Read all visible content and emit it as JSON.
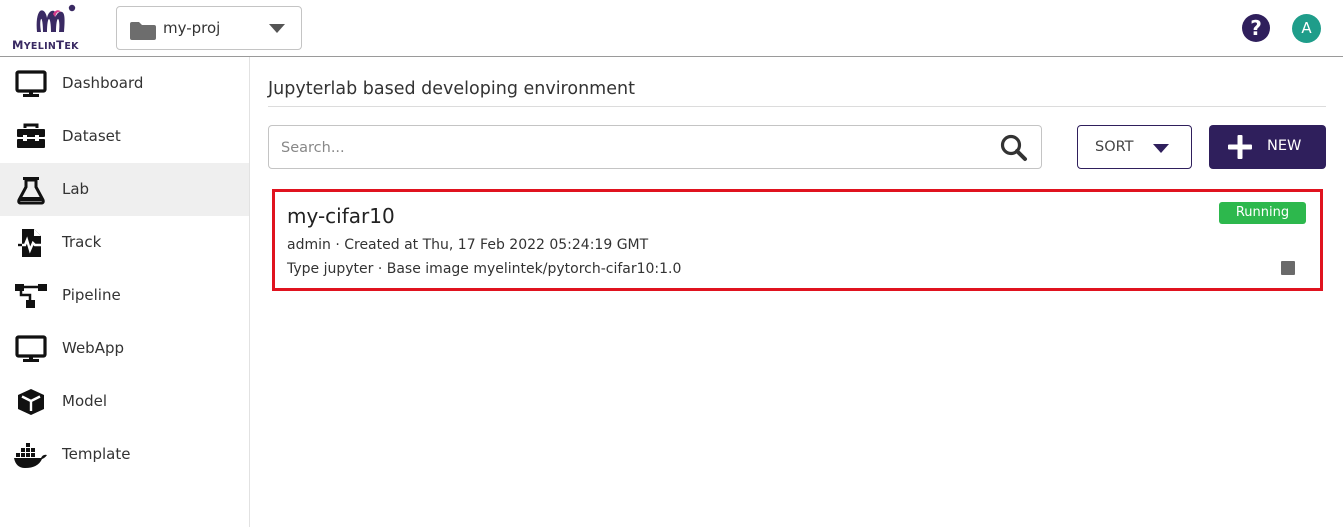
{
  "header": {
    "logo_text_big": "M",
    "logo_text_small": "YELIN",
    "logo_text_big2": "T",
    "logo_text_small2": "EK",
    "project": "my-proj",
    "help_glyph": "?",
    "avatar_letter": "A",
    "icons": [
      "folder-icon",
      "chevron-down-icon",
      "help-icon"
    ]
  },
  "sidebar": {
    "items": [
      {
        "label": "Dashboard",
        "icon": "monitor-icon"
      },
      {
        "label": "Dataset",
        "icon": "toolbox-icon"
      },
      {
        "label": "Lab",
        "icon": "flask-icon",
        "active": true
      },
      {
        "label": "Track",
        "icon": "file-pulse-icon"
      },
      {
        "label": "Pipeline",
        "icon": "sitemap-icon"
      },
      {
        "label": "WebApp",
        "icon": "monitor-icon"
      },
      {
        "label": "Model",
        "icon": "cube-icon"
      },
      {
        "label": "Template",
        "icon": "docker-icon"
      }
    ]
  },
  "main": {
    "title": "Jupyterlab based developing environment",
    "search_placeholder": "Search...",
    "sort_label": "SORT",
    "new_label": "NEW"
  },
  "labs": [
    {
      "name": "my-cifar10",
      "status": "Running",
      "owner_created": "admin · Created at Thu, 17 Feb 2022 05:24:19 GMT",
      "type_image": "Type jupyter · Base image myelintek/pytorch-cifar10:1.0"
    }
  ],
  "colors": {
    "brand": "#2f1f5c",
    "status_running": "#2db84d",
    "highlight_border": "#e0131f",
    "avatar": "#1f9d8a"
  }
}
